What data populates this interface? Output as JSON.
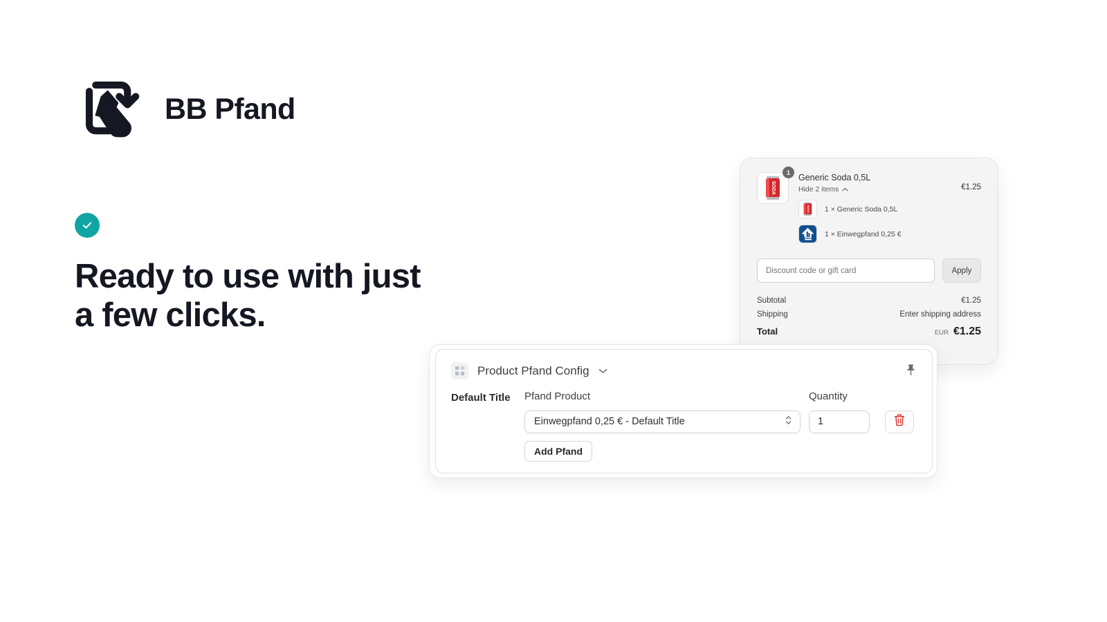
{
  "brand": {
    "name": "BB Pfand",
    "logo_icon": "bottle-recycle-logo"
  },
  "hero": {
    "badge_icon": "check-circle-icon",
    "line1": "Ready to use with just",
    "line2": "a few clicks.",
    "accent_color": "#0EA5A4"
  },
  "cart": {
    "item": {
      "title": "Generic Soda 0,5L",
      "badge_qty": "1",
      "toggle_label": "Hide 2 items",
      "toggle_icon": "chevron-up-icon",
      "price": "€1.25",
      "thumb_icon": "soda-can-icon",
      "sub_items": [
        {
          "label": "1 × Generic Soda 0,5L",
          "icon": "soda-can-icon"
        },
        {
          "label": "1 × Einwegpfand 0,25 €",
          "icon": "deposit-logo-icon"
        }
      ]
    },
    "discount": {
      "placeholder": "Discount code or gift card",
      "value": "",
      "apply_label": "Apply"
    },
    "totals": [
      {
        "label": "Subtotal",
        "value": "€1.25"
      },
      {
        "label": "Shipping",
        "value": "Enter shipping address"
      }
    ],
    "grand_total": {
      "label": "Total",
      "currency": "EUR",
      "amount": "€1.25"
    }
  },
  "config": {
    "title": "Product Pfand Config",
    "header_icon": "app-blocks-icon",
    "chevron_icon": "chevron-down-icon",
    "pin_icon": "pin-icon",
    "columns": {
      "default_title": "Default Title",
      "pfand_product": "Pfand Product",
      "quantity": "Quantity"
    },
    "row": {
      "pfand_product_value": "Einwegpfand 0,25 € - Default Title",
      "quantity_value": "1",
      "stepper_icon": "chevron-up-down-icon",
      "delete_icon": "trash-icon"
    },
    "add_label": "Add Pfand"
  }
}
